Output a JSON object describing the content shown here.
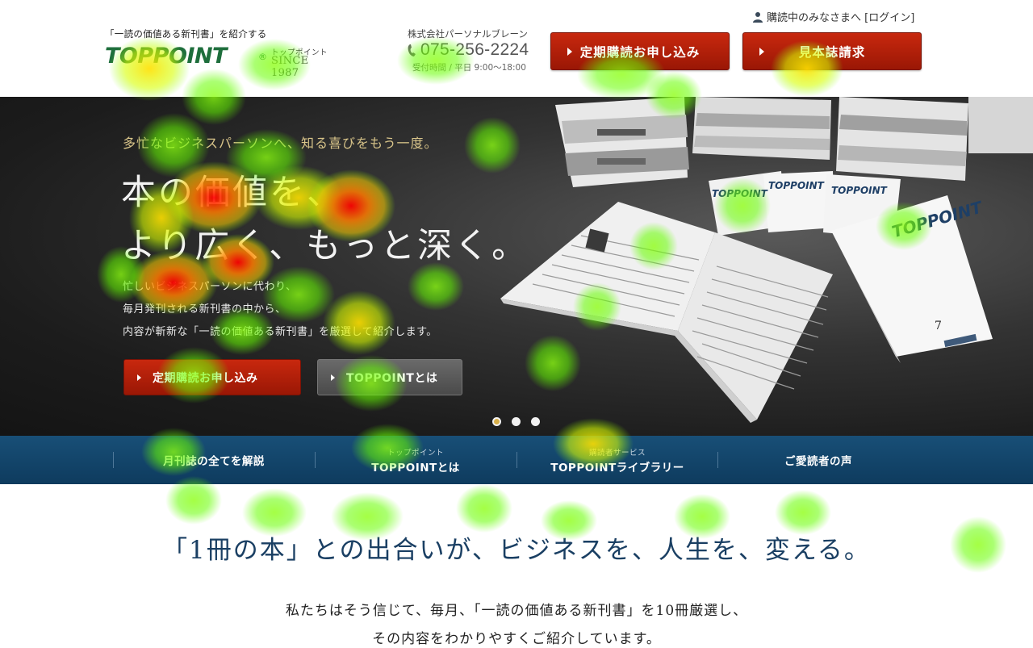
{
  "header": {
    "tagline": "「一読の価値ある新刊書」を紹介する",
    "logo": {
      "wordmark": "TOPPOINT",
      "registered": "®",
      "kana": "トップポイント",
      "since": "SINCE 1987"
    },
    "company": "株式会社パーソナルブレーン",
    "phone": "075-256-2224",
    "hours": "受付時間 / 平日 9:00～18:00",
    "login_text": "購読中のみなさまへ [ログイン]",
    "subscribe_button": "定期購読お申し込み",
    "request_button": "見本誌請求"
  },
  "hero": {
    "catch": "多忙なビジネスパーソンへ、知る喜びをもう一度。",
    "headline_line1": "本の価値を、",
    "headline_line2": "より広く、もっと深く。",
    "desc_line1": "忙しいビジネスパーソンに代わり、",
    "desc_line2": "毎月発刊される新刊書の中から、",
    "desc_line3": "内容が斬新な「一読の価値ある新刊書」を厳選して紹介します。",
    "subscribe_button": "定期購読お申し込み",
    "about_button": "TOPPOINTとは",
    "slides": 3,
    "active_slide": 1,
    "magazine_title": "TOPPOINT",
    "magazine_issue": "7"
  },
  "nav": {
    "items": [
      {
        "sub": "",
        "label": "月刊誌の全てを解説"
      },
      {
        "sub": "トップポイント",
        "label": "TOPPOINTとは"
      },
      {
        "sub": "購読者サービス",
        "label": "TOPPOINTライブラリー"
      },
      {
        "sub": "",
        "label": "ご愛読者の声"
      }
    ]
  },
  "intro": {
    "heading": "「1冊の本」との出合いが、ビジネスを、人生を、変える。",
    "text_line1": "私たちはそう信じて、毎月、「一読の価値ある新刊書」を10冊厳選し、",
    "text_line2": "その内容をわかりやすくご紹介しています。"
  },
  "colors": {
    "brand_green": "#1e6e3c",
    "cta_red": "#b21f0a",
    "nav_blue": "#124a70",
    "heading_navy": "#1a3f63",
    "hero_gold": "#d9c58a"
  }
}
